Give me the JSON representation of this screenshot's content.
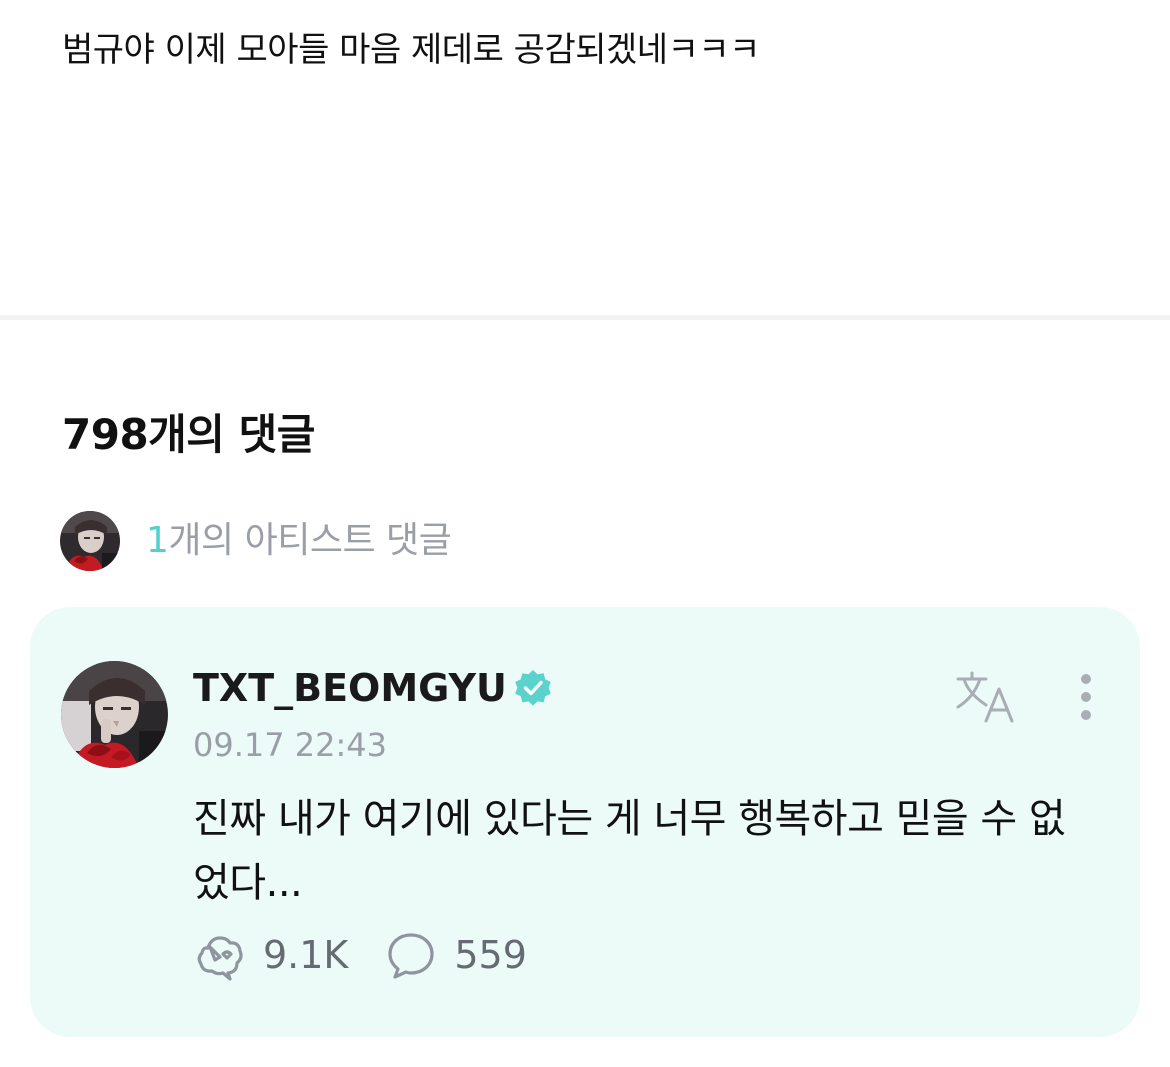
{
  "post": {
    "text": "범규야 이제 모아들 마음 제데로 공감되겠네ㅋㅋㅋ"
  },
  "comments": {
    "title": "798개의 댓글",
    "artist_summary": {
      "count": "1",
      "label": "개의 아티스트 댓글"
    }
  },
  "artist_comment": {
    "username": "TXT_BEOMGYU",
    "timestamp": "09.17 22:43",
    "body": "진짜 내가 여기에 있다는 게 너무 행복하고 믿을 수 없었다...",
    "likes": "9.1K",
    "replies": "559",
    "icons": {
      "verified": "verified-badge-icon",
      "translate": "translate-icon",
      "more": "more-vertical-icon",
      "like": "like-icon",
      "reply": "comment-bubble-icon"
    }
  },
  "colors": {
    "accent": "#4fd1cf",
    "card_background": "#ecfbf8",
    "muted_text": "#9a9ea6",
    "verified_badge": "#5bd3cc"
  }
}
